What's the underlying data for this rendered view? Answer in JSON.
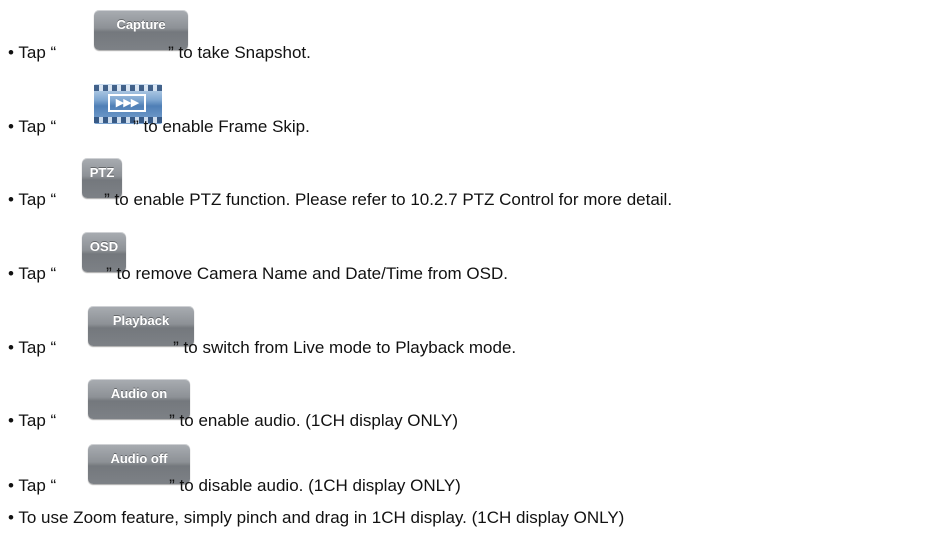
{
  "bullet": "•",
  "items": [
    {
      "prefix": "Tap “",
      "button_label": "Capture",
      "suffix": "” to take Snapshot."
    },
    {
      "prefix": "Tap “",
      "icon": "frame-skip-icon",
      "icon_glyph": "▶▶▶",
      "suffix": "” to enable Frame Skip."
    },
    {
      "prefix": "Tap “",
      "button_label": "PTZ",
      "suffix": "” to enable PTZ function. Please refer to 10.2.7 PTZ Control for more detail."
    },
    {
      "prefix": "Tap “",
      "button_label": "OSD",
      "suffix": "” to remove Camera Name and Date/Time from OSD."
    },
    {
      "prefix": "Tap “",
      "button_label": "Playback",
      "suffix": "” to switch from Live mode to Playback mode."
    },
    {
      "prefix": "Tap “",
      "button_label": "Audio on",
      "suffix": "” to enable audio. (1CH display ONLY)"
    },
    {
      "prefix": "Tap “",
      "button_label": "Audio off",
      "suffix": "” to disable audio. (1CH display ONLY)"
    },
    {
      "text": "To use Zoom feature, simply pinch and drag in 1CH display. (1CH display ONLY)"
    }
  ]
}
